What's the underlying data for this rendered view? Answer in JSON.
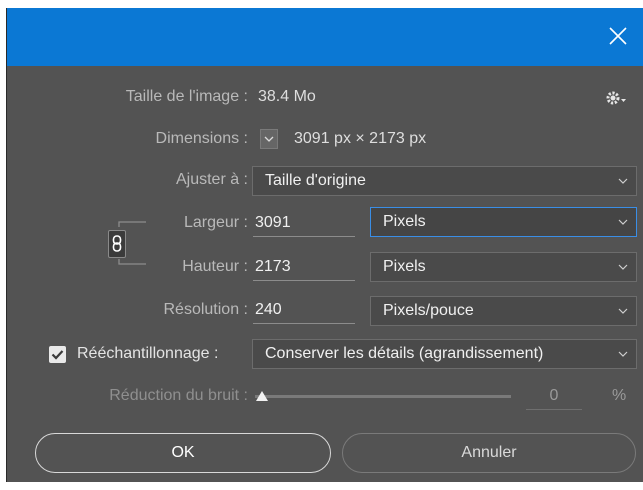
{
  "image_size": {
    "label": "Taille de l'image :",
    "value": "38.4 Mo"
  },
  "dimensions": {
    "label": "Dimensions :",
    "value": "3091 px  ×  2173 px"
  },
  "fit_to": {
    "label": "Ajuster à :",
    "value": "Taille d'origine"
  },
  "width": {
    "label": "Largeur :",
    "value": "3091",
    "unit": "Pixels"
  },
  "height": {
    "label": "Hauteur :",
    "value": "2173",
    "unit": "Pixels"
  },
  "resolution": {
    "label": "Résolution :",
    "value": "240",
    "unit": "Pixels/pouce"
  },
  "resample": {
    "label": "Rééchantillonnage :",
    "checked": true,
    "value": "Conserver les détails (agrandissement)"
  },
  "noise": {
    "label": "Réduction du bruit :",
    "value": "0",
    "unit": "%",
    "level": 0
  },
  "buttons": {
    "ok": "OK",
    "cancel": "Annuler"
  },
  "colors": {
    "titlebar": "#0b78d4",
    "dialog": "#535353",
    "focus": "#3a8ee6"
  },
  "icons": {
    "close": "close-icon",
    "settings": "gear-icon",
    "link": "chain-link-icon"
  }
}
